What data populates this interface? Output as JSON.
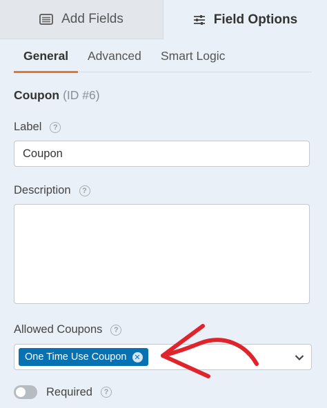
{
  "top_tabs": {
    "add_fields": "Add Fields",
    "field_options": "Field Options"
  },
  "sub_tabs": {
    "general": "General",
    "advanced": "Advanced",
    "smart_logic": "Smart Logic"
  },
  "field": {
    "name": "Coupon",
    "id": "(ID #6)"
  },
  "label_field": {
    "label": "Label",
    "value": "Coupon"
  },
  "description_field": {
    "label": "Description",
    "value": ""
  },
  "allowed_coupons": {
    "label": "Allowed Coupons",
    "selected": "One Time Use Coupon"
  },
  "required": {
    "label": "Required",
    "on": false
  },
  "help_glyph": "?",
  "colors": {
    "accent_orange": "#e27730",
    "chip_blue": "#0871b2",
    "annotation_red": "#e0242b",
    "panel_bg": "#eaf0f7"
  },
  "icons": [
    "list-icon",
    "sliders-icon",
    "help-icon",
    "remove-icon",
    "chevron-down-icon",
    "annotation-arrow"
  ]
}
